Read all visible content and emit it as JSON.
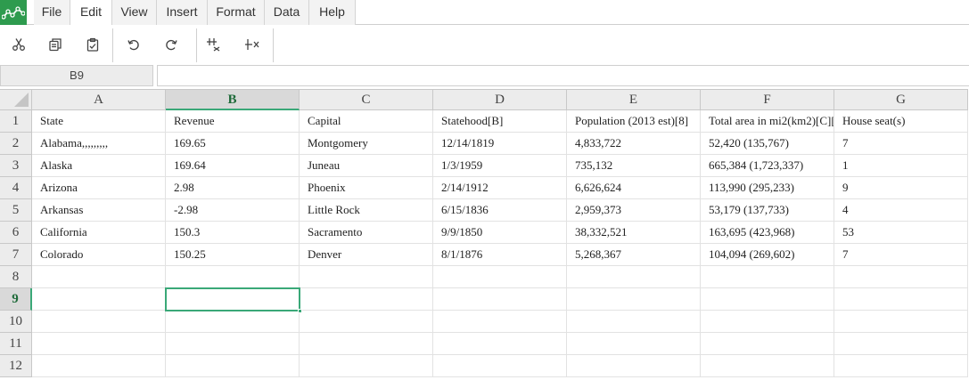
{
  "app": {
    "logo_icon": "spreadsheet-logo-icon",
    "brand_color": "#2e9b4e",
    "accent_color": "#3aa878"
  },
  "menu": {
    "items": [
      {
        "label": "File"
      },
      {
        "label": "Edit"
      },
      {
        "label": "View"
      },
      {
        "label": "Insert"
      },
      {
        "label": "Format"
      },
      {
        "label": "Data"
      },
      {
        "label": "Help"
      }
    ],
    "active": "Edit"
  },
  "toolbar": {
    "buttons": [
      {
        "icon": "cut-icon"
      },
      {
        "icon": "copy-icon"
      },
      {
        "icon": "paste-icon"
      },
      {
        "icon": "undo-icon"
      },
      {
        "icon": "redo-icon"
      },
      {
        "icon": "insert-column-icon"
      },
      {
        "icon": "delete-column-icon"
      }
    ]
  },
  "formula_bar": {
    "name_box": "B9",
    "formula": ""
  },
  "sheet": {
    "columns": [
      "A",
      "B",
      "C",
      "D",
      "E",
      "F",
      "G"
    ],
    "selected_column": "B",
    "selected_row": "9",
    "rows": [
      {
        "num": "1",
        "cells": [
          "State",
          "Revenue",
          "Capital",
          "Statehood[B]",
          "Population (2013 est)[8]",
          "Total area in mi2(km2)[C][",
          "House seat(s)"
        ]
      },
      {
        "num": "2",
        "cells": [
          "Alabama,,,,,,,,,",
          "169.65",
          "Montgomery",
          "12/14/1819",
          "4,833,722",
          "52,420 (135,767)",
          "7"
        ]
      },
      {
        "num": "3",
        "cells": [
          "Alaska",
          "169.64",
          "Juneau",
          "1/3/1959",
          "735,132",
          "665,384 (1,723,337)",
          "1"
        ]
      },
      {
        "num": "4",
        "cells": [
          "Arizona",
          "2.98",
          "Phoenix",
          "2/14/1912",
          "6,626,624",
          "113,990 (295,233)",
          "9"
        ]
      },
      {
        "num": "5",
        "cells": [
          "Arkansas",
          "-2.98",
          "Little Rock",
          "6/15/1836",
          "2,959,373",
          "53,179 (137,733)",
          "4"
        ]
      },
      {
        "num": "6",
        "cells": [
          "California",
          "150.3",
          "Sacramento",
          "9/9/1850",
          "38,332,521",
          "163,695 (423,968)",
          "53"
        ]
      },
      {
        "num": "7",
        "cells": [
          "Colorado",
          "150.25",
          "Denver",
          "8/1/1876",
          "5,268,367",
          "104,094 (269,602)",
          "7"
        ]
      },
      {
        "num": "8",
        "cells": [
          "",
          "",
          "",
          "",
          "",
          "",
          ""
        ]
      },
      {
        "num": "9",
        "cells": [
          "",
          "",
          "",
          "",
          "",
          "",
          ""
        ]
      },
      {
        "num": "10",
        "cells": [
          "",
          "",
          "",
          "",
          "",
          "",
          ""
        ]
      },
      {
        "num": "11",
        "cells": [
          "",
          "",
          "",
          "",
          "",
          "",
          ""
        ]
      },
      {
        "num": "12",
        "cells": [
          "",
          "",
          "",
          "",
          "",
          "",
          ""
        ]
      }
    ]
  }
}
